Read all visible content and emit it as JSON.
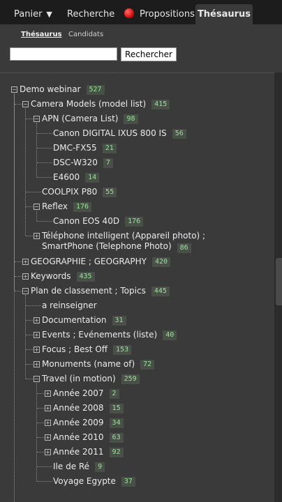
{
  "tabs": [
    {
      "label": "Panier",
      "has_caret": true
    },
    {
      "label": "Recherche"
    },
    {
      "label": "Propositions",
      "icon": "red-dot-icon"
    },
    {
      "label": "Thésaurus",
      "active": true
    }
  ],
  "caret_glyph": "▼",
  "subtabs": [
    {
      "label": "Thésaurus",
      "active": true
    },
    {
      "label": "Candidats"
    }
  ],
  "search": {
    "value": "",
    "button_label": "Rechercher"
  },
  "colors": {
    "background": "#3a3a3a",
    "tabbar": "#1c1c1c",
    "badge_bg": "#485048",
    "badge_text": "#9be39b",
    "alert_dot": "#d40000"
  },
  "tree": [
    {
      "label": "Demo webinar",
      "count": "527",
      "toggle": "collapse",
      "children": [
        {
          "label": "Camera Models (model list)",
          "count": "415",
          "toggle": "collapse",
          "children": [
            {
              "label": "APN (Camera List)",
              "count": "98",
              "toggle": "collapse",
              "children": [
                {
                  "label": "Canon DIGITAL IXUS 800 IS",
                  "count": "56"
                },
                {
                  "label": "DMC-FX55",
                  "count": "21"
                },
                {
                  "label": "DSC-W320",
                  "count": "7"
                },
                {
                  "label": "E4600",
                  "count": "14"
                }
              ]
            },
            {
              "label": "COOLPIX P80",
              "count": "55"
            },
            {
              "label": "Reflex",
              "count": "176",
              "toggle": "collapse",
              "children": [
                {
                  "label": "Canon EOS 40D",
                  "count": "176"
                }
              ]
            },
            {
              "label": "Téléphone intelligent (Appareil photo) ;",
              "label2": "SmartPhone (Telephone Photo)",
              "count": "86",
              "toggle": "expand"
            }
          ]
        },
        {
          "label": "GEOGRAPHIE ; GEOGRAPHY",
          "count": "420",
          "toggle": "expand"
        },
        {
          "label": "Keywords",
          "count": "435",
          "toggle": "expand"
        },
        {
          "label": "Plan de classement ; Topics",
          "count": "445",
          "toggle": "collapse",
          "children": [
            {
              "label": "a reinseigner"
            },
            {
              "label": "Documentation",
              "count": "31",
              "toggle": "expand"
            },
            {
              "label": "Events ; Evénements (liste)",
              "count": "40",
              "toggle": "expand"
            },
            {
              "label": "Focus ; Best Off",
              "count": "153",
              "toggle": "expand"
            },
            {
              "label": "Monuments (name of)",
              "count": "72",
              "toggle": "expand"
            },
            {
              "label": "Travel (in motion)",
              "count": "259",
              "toggle": "collapse",
              "children": [
                {
                  "label": "Année 2007",
                  "count": "2",
                  "toggle": "expand"
                },
                {
                  "label": "Année 2008",
                  "count": "15",
                  "toggle": "expand"
                },
                {
                  "label": "Année 2009",
                  "count": "34",
                  "toggle": "expand"
                },
                {
                  "label": "Année 2010",
                  "count": "63",
                  "toggle": "expand"
                },
                {
                  "label": "Année 2011",
                  "count": "92",
                  "toggle": "expand"
                },
                {
                  "label": "Ile de Ré",
                  "count": "9"
                },
                {
                  "label": "Voyage Egypte",
                  "count": "37"
                }
              ]
            }
          ]
        }
      ]
    }
  ]
}
